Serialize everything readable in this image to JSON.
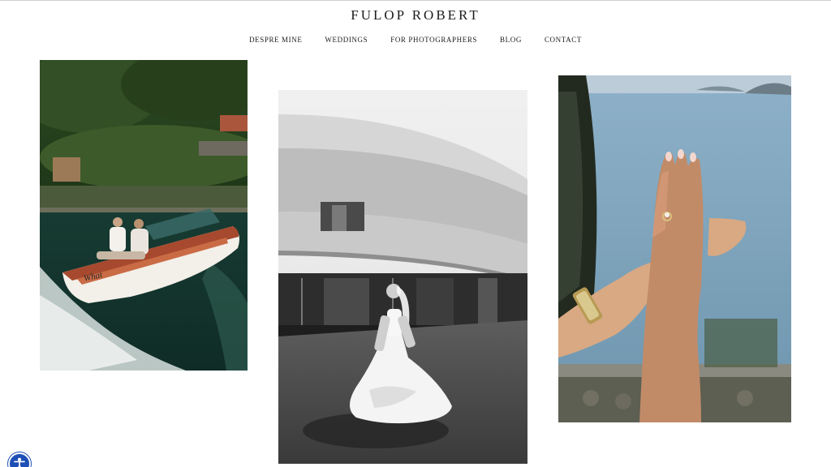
{
  "site": {
    "title": "FULOP ROBERT"
  },
  "nav": {
    "items": [
      {
        "label": "DESPRE MINE"
      },
      {
        "label": "WEDDINGS"
      },
      {
        "label": "FOR PHOTOGRAPHERS"
      },
      {
        "label": "BLOG"
      },
      {
        "label": "CONTACT"
      }
    ]
  },
  "gallery": {
    "photos": [
      {
        "name": "boat",
        "boat_text": "What"
      },
      {
        "name": "bride"
      },
      {
        "name": "hands"
      }
    ]
  },
  "accessibility": {
    "icon": "accessibility-icon",
    "color": "#1d4fb6"
  }
}
